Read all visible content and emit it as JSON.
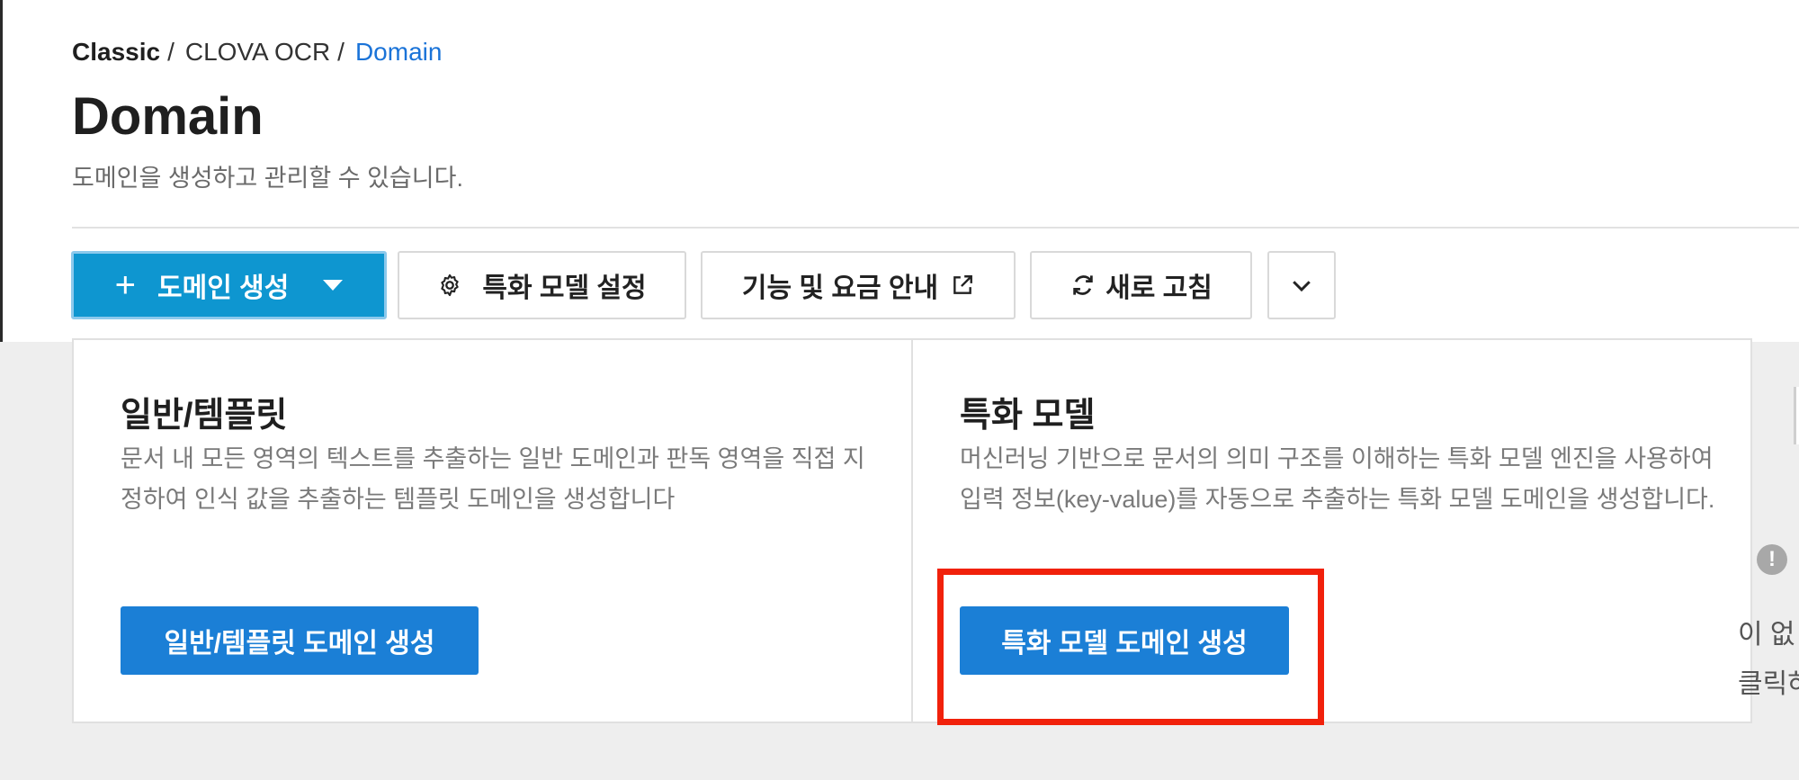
{
  "breadcrumb": [
    {
      "label": "Classic"
    },
    {
      "label": "CLOVA OCR"
    },
    {
      "label": "Domain"
    }
  ],
  "breadcrumb_separator": "/",
  "page": {
    "title": "Domain",
    "description": "도메인을 생성하고 관리할 수 있습니다."
  },
  "toolbar": {
    "create_label": "도메인 생성",
    "special_label": "특화 모델 설정",
    "pricing_label": "기능 및 요금 안내",
    "refresh_label": "새로 고침"
  },
  "cards": [
    {
      "title": "일반/템플릿",
      "description": "문서 내 모든 영역의 텍스트를 추출하는 일반 도메인과 판독 영역을 직접 지정하여 인식 값을 추출하는 템플릿 도메인을 생성합니다",
      "button_label": "일반/템플릿 도메인 생성"
    },
    {
      "title": "특화 모델",
      "description": "머신러닝 기반으로 문서의 의미 구조를 이해하는 특화 모델 엔진을 사용하여 입력 정보(key-value)를 자동으로 추출하는 특화 모델 도메인을 생성합니다.",
      "button_label": "특화 모델 도메인 생성"
    }
  ],
  "right_partial": {
    "line1": "이 없",
    "line2": "클릭하"
  },
  "icons": {
    "plus": "plus-icon",
    "caret": "caret-down-icon",
    "gear": "gear-icon",
    "external": "external-link-icon",
    "refresh": "refresh-icon",
    "chevron": "chevron-down-icon",
    "info": "info-icon"
  },
  "colors": {
    "primary_button": "#0e96d0",
    "card_button": "#1b7fd6",
    "breadcrumb_active": "#1a73d8",
    "highlight_box": "#f1210b"
  }
}
